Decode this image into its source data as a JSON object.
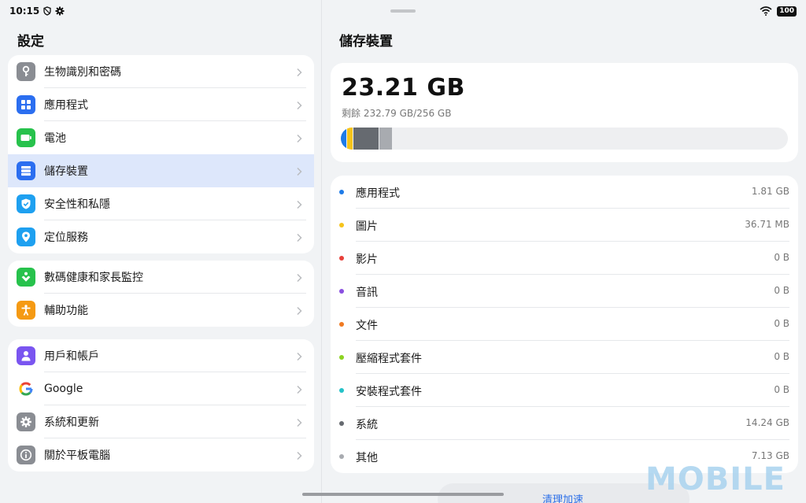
{
  "status": {
    "time": "10:15",
    "battery": "100"
  },
  "left": {
    "title": "設定",
    "groups": [
      {
        "items": [
          {
            "label": "生物識別和密碼",
            "icon": "key-icon",
            "color": "#8a8d93"
          },
          {
            "label": "應用程式",
            "icon": "apps-grid-icon",
            "color": "#2b6ef0"
          },
          {
            "label": "電池",
            "icon": "battery-icon",
            "color": "#27c24c"
          },
          {
            "label": "儲存裝置",
            "icon": "storage-icon",
            "color": "#2b6ef0",
            "selected": true
          },
          {
            "label": "安全性和私隱",
            "icon": "shield-icon",
            "color": "#1ea0f0"
          },
          {
            "label": "定位服務",
            "icon": "location-pin-icon",
            "color": "#1ea0f0"
          }
        ]
      },
      {
        "items": [
          {
            "label": "數碼健康和家長監控",
            "icon": "digital-wellbeing-icon",
            "color": "#27c24c"
          },
          {
            "label": "輔助功能",
            "icon": "accessibility-icon",
            "color": "#f59a13"
          }
        ]
      },
      {
        "items": [
          {
            "label": "用戶和帳戶",
            "icon": "user-icon",
            "color": "#7a55f0"
          },
          {
            "label": "Google",
            "icon": "google-icon",
            "color": "#ffffff"
          },
          {
            "label": "系統和更新",
            "icon": "gear-icon",
            "color": "#8a8d93"
          },
          {
            "label": "關於平板電腦",
            "icon": "info-icon",
            "color": "#8a8d93"
          }
        ]
      }
    ]
  },
  "right": {
    "title": "儲存裝置",
    "used": "23.21 GB",
    "remaining": "剩餘 232.79 GB/256 GB",
    "categories": [
      {
        "name": "應用程式",
        "size": "1.81 GB",
        "color": "#1e7be8"
      },
      {
        "name": "圖片",
        "size": "36.71 MB",
        "color": "#f6c41b"
      },
      {
        "name": "影片",
        "size": "0 B",
        "color": "#e8403a"
      },
      {
        "name": "音訊",
        "size": "0 B",
        "color": "#8a4fe0"
      },
      {
        "name": "文件",
        "size": "0 B",
        "color": "#f07a22"
      },
      {
        "name": "壓縮程式套件",
        "size": "0 B",
        "color": "#8cd321"
      },
      {
        "name": "安裝程式套件",
        "size": "0 B",
        "color": "#25c2c8"
      },
      {
        "name": "系統",
        "size": "14.24 GB",
        "color": "#666a70"
      },
      {
        "name": "其他",
        "size": "7.13 GB",
        "color": "#a8abb0"
      }
    ],
    "bar_segments": [
      {
        "name": "應用程式",
        "color": "#1e7be8",
        "fraction": 0.0125
      },
      {
        "name": "圖片",
        "color": "#f6c41b",
        "fraction": 0.012
      },
      {
        "name": "系統",
        "color": "#666a70",
        "fraction": 0.056
      },
      {
        "name": "其他",
        "color": "#a8abb0",
        "fraction": 0.028
      }
    ],
    "clean_button": "清理加速"
  },
  "watermark": "MOBILE"
}
